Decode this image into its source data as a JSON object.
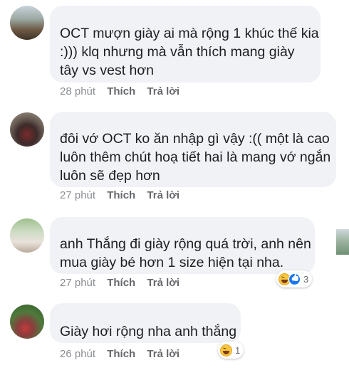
{
  "comments": [
    {
      "text_lines": [
        "OCT mượn giày ai mà rộng 1 khúc thế kia",
        ":))) klq nhưng mà vẫn thích mang giày",
        "tây vs vest hơn"
      ],
      "time": "28 phút",
      "like_label": "Thích",
      "reply_label": "Trả lời"
    },
    {
      "text_lines": [
        "đôi vớ OCT ko ăn nhập gì vậy :(( một là cao",
        "luôn thêm chút hoạ tiết hai là mang vớ ngắn",
        "luôn sẽ đẹp hơn"
      ],
      "time": "27 phút",
      "like_label": "Thích",
      "reply_label": "Trả lời"
    },
    {
      "text_lines": [
        "anh Thắng đi giày rộng quá trời, anh nên",
        "mua giày bé hơn 1 size hiện tại nha."
      ],
      "time": "27 phút",
      "like_label": "Thích",
      "reply_label": "Trả lời",
      "reaction_count": "3"
    },
    {
      "text_lines": [
        "Giày hơi rộng nha anh thắng"
      ],
      "time": "26 phút",
      "like_label": "Thích",
      "reply_label": "Trả lời",
      "reaction_count": "1"
    }
  ]
}
